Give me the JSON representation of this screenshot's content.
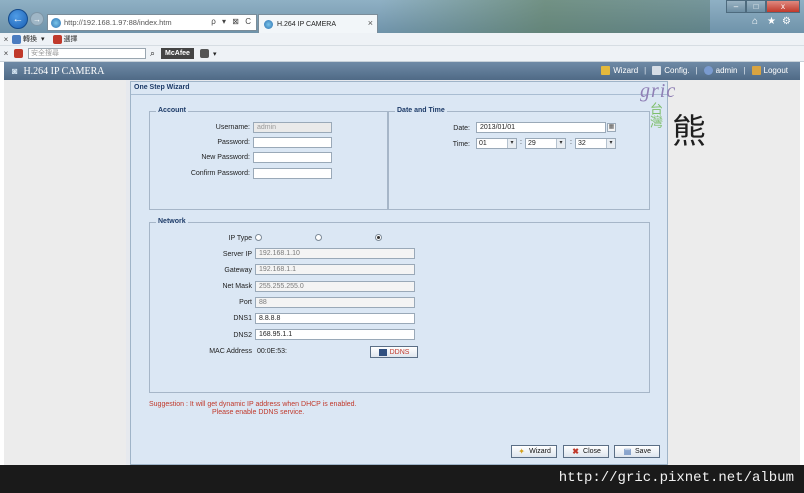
{
  "browser": {
    "address_url": "http://192.168.1.97:88/index.htm",
    "address_tools": "ρ ▾ ⊠ C",
    "tab_title": "H.264 IP CAMERA",
    "tab_close": "×",
    "window_buttons": [
      "–",
      "□",
      "x"
    ],
    "right_icons": [
      "⌂",
      "★",
      "⚙"
    ],
    "toolbar1_items": [
      "轉換",
      "選擇"
    ],
    "toolbar2": {
      "search_placeholder": "安全搜尋",
      "mcafee_label": "McAfee"
    }
  },
  "app": {
    "title": "H.264 IP CAMERA",
    "nav": {
      "wizard": "Wizard",
      "config": "Config.",
      "user": "admin",
      "logout": "Logout"
    }
  },
  "wizard": {
    "title": "One Step Wizard",
    "account": {
      "legend": "Account",
      "username_label": "Username:",
      "username_value": "admin",
      "password_label": "Password:",
      "new_password_label": "New Password:",
      "confirm_password_label": "Confirm Password:"
    },
    "datetime": {
      "legend": "Date and Time",
      "date_label": "Date:",
      "date_value": "2013/01/01",
      "time_label": "Time:",
      "hour": "01",
      "minute": "29",
      "second": "32"
    },
    "network": {
      "legend": "Network",
      "ip_type_label": "IP Type",
      "ip_type_selected": 2,
      "server_ip_label": "Server IP",
      "server_ip_value": "192.168.1.10",
      "gateway_label": "Gateway",
      "gateway_value": "192.168.1.1",
      "netmask_label": "Net Mask",
      "netmask_value": "255.255.255.0",
      "port_label": "Port",
      "port_value": "88",
      "dns1_label": "DNS1",
      "dns1_value": "8.8.8.8",
      "dns2_label": "DNS2",
      "dns2_value": "168.95.1.1",
      "mac_label": "MAC Address",
      "mac_value": "00:0E:53:",
      "ddns_button": "DDNS"
    },
    "suggestion_line1": "Suggestion : It will get dynamic IP address when DHCP is enabled.",
    "suggestion_line2": "Please enable DDNS service.",
    "buttons": {
      "wizard": "Wizard",
      "close": "Close",
      "save": "Save"
    }
  },
  "watermark": {
    "logo_top": "gric",
    "logo_left": "台灣",
    "logo_right": "熊",
    "url": "http://gric.pixnet.net/album"
  }
}
